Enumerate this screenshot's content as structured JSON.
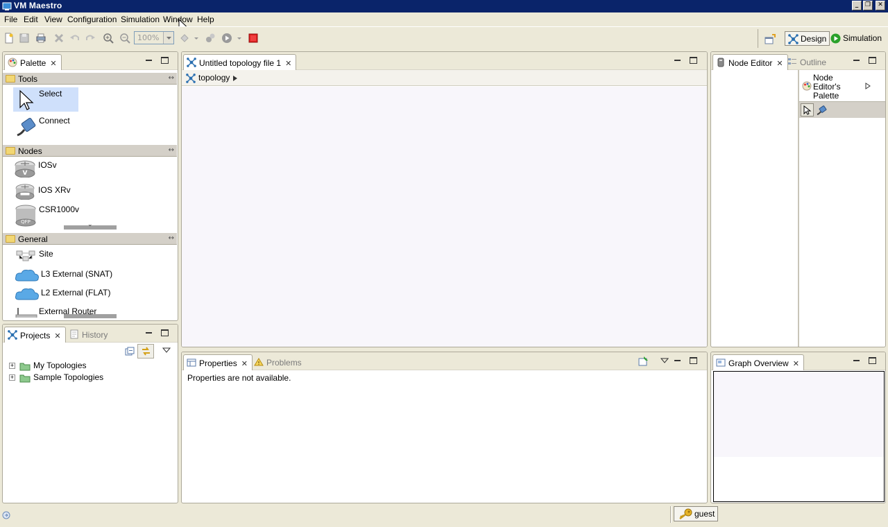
{
  "window": {
    "title": "VM Maestro"
  },
  "menu": [
    "File",
    "Edit",
    "View",
    "Configuration",
    "Simulation",
    "Window",
    "Help"
  ],
  "toolbar": {
    "zoom_value": "100%"
  },
  "perspectives": {
    "design": "Design",
    "simulation": "Simulation"
  },
  "palette": {
    "tab": "Palette",
    "drawers": {
      "tools": {
        "label": "Tools",
        "items": [
          "Select",
          "Connect"
        ]
      },
      "nodes": {
        "label": "Nodes",
        "items": [
          "IOSv",
          "IOS XRv",
          "CSR1000v"
        ]
      },
      "general": {
        "label": "General",
        "items": [
          "Site",
          "L3 External (SNAT)",
          "L2 External (FLAT)",
          "External Router"
        ]
      }
    }
  },
  "editor": {
    "tab": "Untitled topology file 1",
    "breadcrumb": "topology"
  },
  "node_editor": {
    "tab": "Node Editor",
    "outline_tab": "Outline",
    "palette_label": "Node Editor's Palette"
  },
  "projects": {
    "tab": "Projects",
    "history_tab": "History",
    "items": [
      "My Topologies",
      "Sample Topologies"
    ]
  },
  "properties": {
    "tab": "Properties",
    "problems_tab": "Problems",
    "message": "Properties are not available."
  },
  "graph_overview": {
    "tab": "Graph Overview"
  },
  "status": {
    "user": "guest"
  },
  "colors": {
    "titlebar": "#0a246a",
    "chrome": "#ece9d8",
    "canvas": "#f8f6fb",
    "selection": "#cfe0fb"
  }
}
